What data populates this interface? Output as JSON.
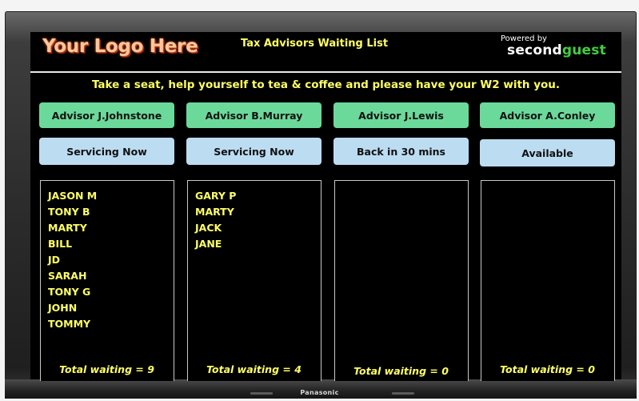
{
  "device": {
    "brand": "Panasonic"
  },
  "header": {
    "logo_text": "Your Logo Here",
    "title": "Tax Advisors Waiting List",
    "powered_by": "Powered by",
    "brand_part1": "second",
    "brand_part2": "guest"
  },
  "banner": "Take a seat, help yourself to tea & coffee and please have your W2 with you.",
  "colors": {
    "screen_background": "#000000",
    "advisor_button": "#6bd99a",
    "status_button": "#bcdcf2",
    "accent_text": "#ffff66",
    "brand_green": "#3fce3f"
  },
  "advisors": [
    {
      "name": "Advisor J.Johnstone",
      "status": "Servicing Now",
      "queue": [
        "JASON M",
        "TONY B",
        "MARTY",
        "BILL",
        "JD",
        "SARAH",
        "TONY G",
        "JOHN",
        "TOMMY"
      ],
      "total": "Total waiting = 9"
    },
    {
      "name": "Advisor B.Murray",
      "status": "Servicing Now",
      "queue": [
        "GARY P",
        "MARTY",
        "JACK",
        "JANE"
      ],
      "total": "Total waiting = 4"
    },
    {
      "name": "Advisor J.Lewis",
      "status": "Back in 30 mins",
      "queue": [],
      "total": "Total waiting = 0"
    },
    {
      "name": "Advisor A.Conley",
      "status": "Available",
      "queue": [],
      "total": "Total waiting = 0"
    }
  ]
}
